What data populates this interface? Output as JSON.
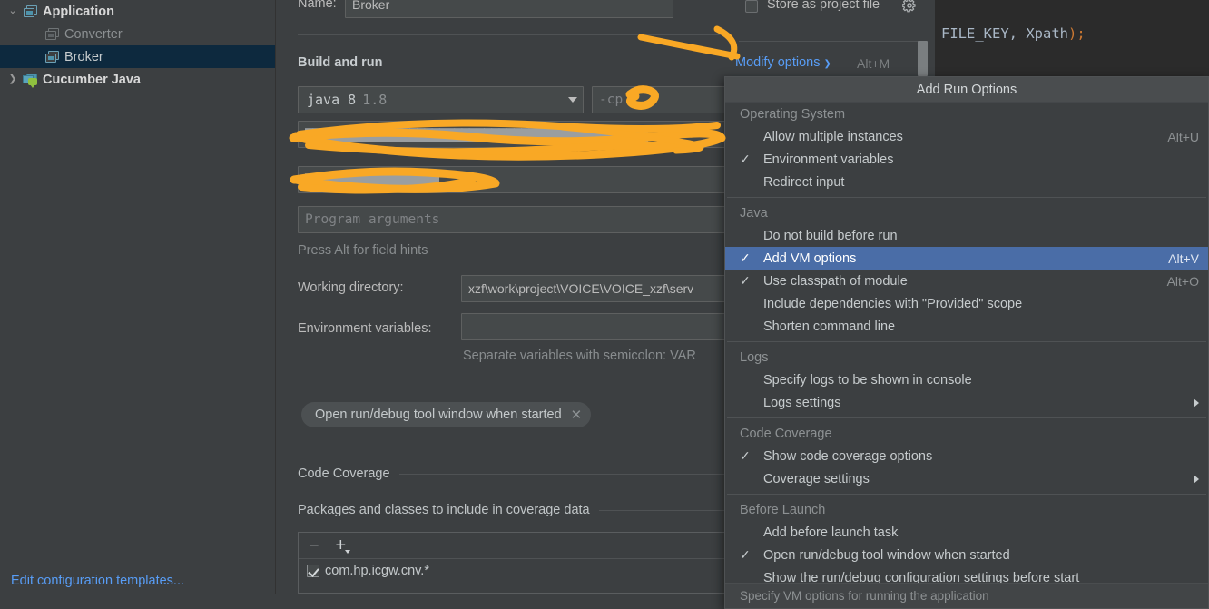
{
  "editor": {
    "visible_code_fragment": "FILE_KEY, Xpath);",
    "code_text": "FILE_KEY, Xpath",
    "code_punctuation": ");"
  },
  "sidebar": {
    "items": [
      {
        "label": "Application",
        "icon": "application-window-icon",
        "expanded": true,
        "twisty": "⌄",
        "depth": 0,
        "style": "bold",
        "selected": false
      },
      {
        "label": "Converter",
        "icon": "application-window-icon",
        "depth": 1,
        "style": "dim",
        "selected": false
      },
      {
        "label": "Broker",
        "icon": "application-window-icon",
        "depth": 1,
        "style": "norm",
        "selected": true
      },
      {
        "label": "Cucumber Java",
        "icon": "cucumber-java-icon",
        "expanded": false,
        "twisty": "❯",
        "depth": 0,
        "style": "bold",
        "selected": false
      }
    ],
    "edit_templates_link": "Edit configuration templates..."
  },
  "form": {
    "name_label": "Name:",
    "name_value": "Broker",
    "store_as_project_file_label": "Store as project file",
    "store_as_project_file_checked": false,
    "gear_icon": "gear-icon",
    "build_and_run_title": "Build and run",
    "modify_options_label": "Modify options",
    "modify_options_accel": "Alt+M",
    "jdk_name": "java 8",
    "jdk_version": "1.8",
    "cp_value": "-cp",
    "main_class_redacted": "██████████████████████████████████████████████",
    "vm_options_redacted": "██████████████████",
    "program_arguments_placeholder": "Program arguments",
    "field_hints_note": "Press Alt for field hints",
    "working_directory_label": "Working directory:",
    "working_directory_value": "xzf\\work\\project\\VOICE\\VOICE_xzf\\serv",
    "environment_variables_label": "Environment variables:",
    "environment_variables_value": "",
    "environment_variables_hint": "Separate variables with semicolon: VAR",
    "before_launch_chip": "Open run/debug tool window when started",
    "chip_remove_icon": "close-icon",
    "code_coverage_group": "Code Coverage",
    "coverage_packages_group": "Packages and classes to include in coverage data",
    "coverage_list": {
      "remove_icon": "minus-icon",
      "add_icon": "plus-icon",
      "rows": [
        {
          "checked": true,
          "label": "com.hp.icgw.cnv.*"
        }
      ]
    }
  },
  "popup": {
    "title": "Add Run Options",
    "footer_hint": "Specify VM options for running the application",
    "sections": [
      {
        "label": "Operating System",
        "items": [
          {
            "label": "Allow multiple instances",
            "checked": false,
            "accel": "Alt+U",
            "selected": false,
            "submenu": false
          },
          {
            "label": "Environment variables",
            "checked": true,
            "accel": "",
            "selected": false,
            "submenu": false
          },
          {
            "label": "Redirect input",
            "checked": false,
            "accel": "",
            "selected": false,
            "submenu": false
          }
        ]
      },
      {
        "label": "Java",
        "items": [
          {
            "label": "Do not build before run",
            "checked": false,
            "accel": "",
            "selected": false,
            "submenu": false
          },
          {
            "label": "Add VM options",
            "checked": true,
            "accel": "Alt+V",
            "selected": true,
            "submenu": false
          },
          {
            "label": "Use classpath of module",
            "checked": true,
            "accel": "Alt+O",
            "selected": false,
            "submenu": false
          },
          {
            "label": "Include dependencies with \"Provided\" scope",
            "checked": false,
            "accel": "",
            "selected": false,
            "submenu": false
          },
          {
            "label": "Shorten command line",
            "checked": false,
            "accel": "",
            "selected": false,
            "submenu": false
          }
        ]
      },
      {
        "label": "Logs",
        "items": [
          {
            "label": "Specify logs to be shown in console",
            "checked": false,
            "accel": "",
            "selected": false,
            "submenu": false
          },
          {
            "label": "Logs settings",
            "checked": false,
            "accel": "",
            "selected": false,
            "submenu": true
          }
        ]
      },
      {
        "label": "Code Coverage",
        "items": [
          {
            "label": "Show code coverage options",
            "checked": true,
            "accel": "",
            "selected": false,
            "submenu": false
          },
          {
            "label": "Coverage settings",
            "checked": false,
            "accel": "",
            "selected": false,
            "submenu": true
          }
        ]
      },
      {
        "label": "Before Launch",
        "items": [
          {
            "label": "Add before launch task",
            "checked": false,
            "accel": "",
            "selected": false,
            "submenu": false
          },
          {
            "label": "Open run/debug tool window when started",
            "checked": true,
            "accel": "",
            "selected": false,
            "submenu": false
          },
          {
            "label": "Show the run/debug configuration settings before start",
            "checked": false,
            "accel": "",
            "selected": false,
            "submenu": false
          }
        ]
      }
    ]
  },
  "annotations": {
    "color": "#F9A825",
    "shapes": [
      "arrow-pointing-to-modify-options",
      "scribble-over-cp-field",
      "scribble-over-main-class-field",
      "scribble-over-vm-options-field"
    ]
  },
  "colors": {
    "window_bg": "#3c3f41",
    "editor_bg": "#2b2b2b",
    "field_bg": "#45494a",
    "selection_blue": "#4a6da7",
    "tree_selection": "#0d293e",
    "link_blue": "#589df6",
    "annotation_orange": "#F9A825",
    "text": "#bbbbbb",
    "muted_text": "#8d9193"
  }
}
